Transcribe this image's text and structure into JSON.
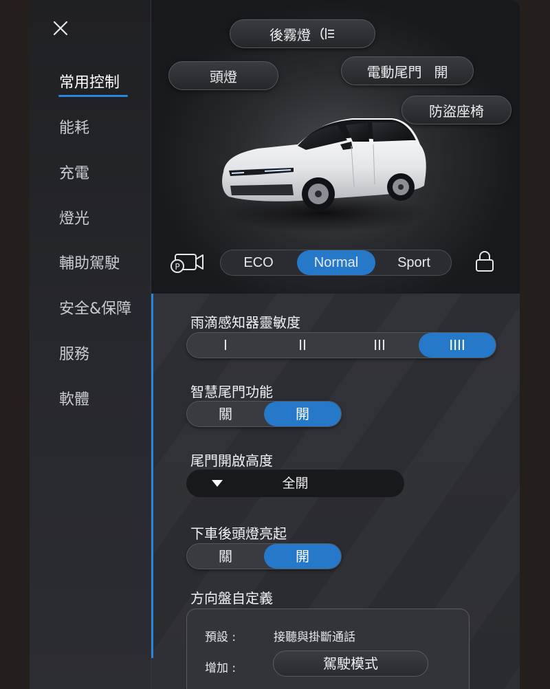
{
  "sidebar": {
    "items": [
      {
        "label": "常用控制",
        "active": true
      },
      {
        "label": "能耗"
      },
      {
        "label": "充電"
      },
      {
        "label": "燈光"
      },
      {
        "label": "輔助駕駛"
      },
      {
        "label": "安全&保障"
      },
      {
        "label": "服務"
      },
      {
        "label": "軟體"
      }
    ]
  },
  "hero": {
    "rear_fog_label": "後霧燈",
    "headlight_label": "頭燈",
    "power_tailgate_label": "電動尾門",
    "power_tailgate_state": "開",
    "anti_theft_seat_label": "防盜座椅",
    "drive_modes": [
      "ECO",
      "Normal",
      "Sport"
    ],
    "active_drive_mode": "Normal",
    "icons": [
      "close-icon",
      "rear-fog-light-icon",
      "parking-camera-icon",
      "lock-icon"
    ]
  },
  "settings": {
    "rain_sensor": {
      "title": "雨滴感知器靈敏度",
      "options": [
        "I",
        "II",
        "III",
        "IIII"
      ],
      "selected": "IIII"
    },
    "smart_tailgate": {
      "title": "智慧尾門功能",
      "options": [
        "關",
        "開"
      ],
      "selected": "開"
    },
    "tailgate_height": {
      "title": "尾門開啟高度",
      "value": "全開"
    },
    "exit_headlights": {
      "title": "下車後頭燈亮起",
      "options": [
        "關",
        "開"
      ],
      "selected": "開"
    },
    "steering_custom": {
      "title": "方向盤自定義",
      "default_key": "預設 :",
      "default_value": "接聽與掛斷通話",
      "add_key": "增加 :",
      "add_value": "駕駛模式"
    }
  },
  "colors": {
    "accent": "#2679c8",
    "background": "#1b1c20"
  }
}
